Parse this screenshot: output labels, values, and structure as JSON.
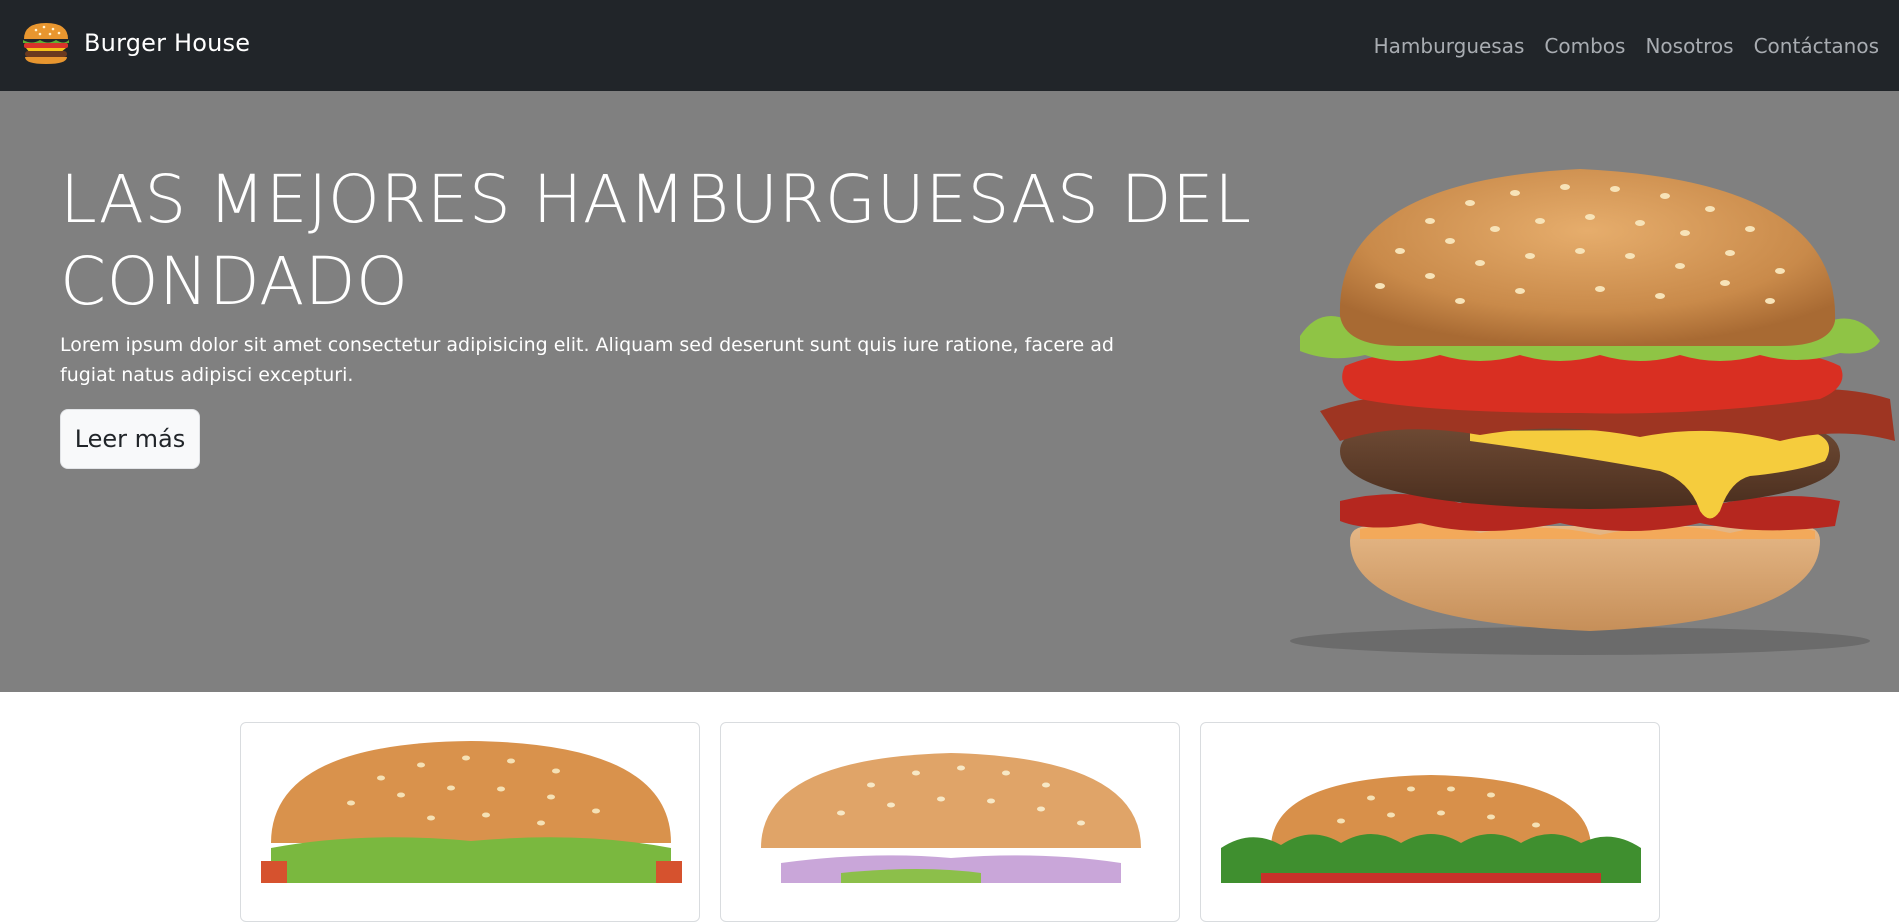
{
  "navbar": {
    "brand_name": "Burger House",
    "logo_icon": "burger-icon",
    "links": [
      "Hamburguesas",
      "Combos",
      "Nosotros",
      "Contáctanos"
    ]
  },
  "hero": {
    "title": "LAS MEJORES HAMBURGUESAS DEL CONDADO",
    "text": "Lorem ipsum dolor sit amet consectetur adipisicing elit. Aliquam sed deserunt sunt quis iure ratione, facere ad fugiat natus adipisci excepturi.",
    "button_label": "Leer más",
    "image": "hamburger-photo"
  },
  "cards": [
    {
      "image": "burger-photo-1"
    },
    {
      "image": "burger-photo-2"
    },
    {
      "image": "burger-photo-3"
    }
  ],
  "colors": {
    "navbar_bg": "#212529",
    "hero_bg": "#808080",
    "nav_link": "#a8acb1",
    "button_bg": "#f8f9fa"
  }
}
